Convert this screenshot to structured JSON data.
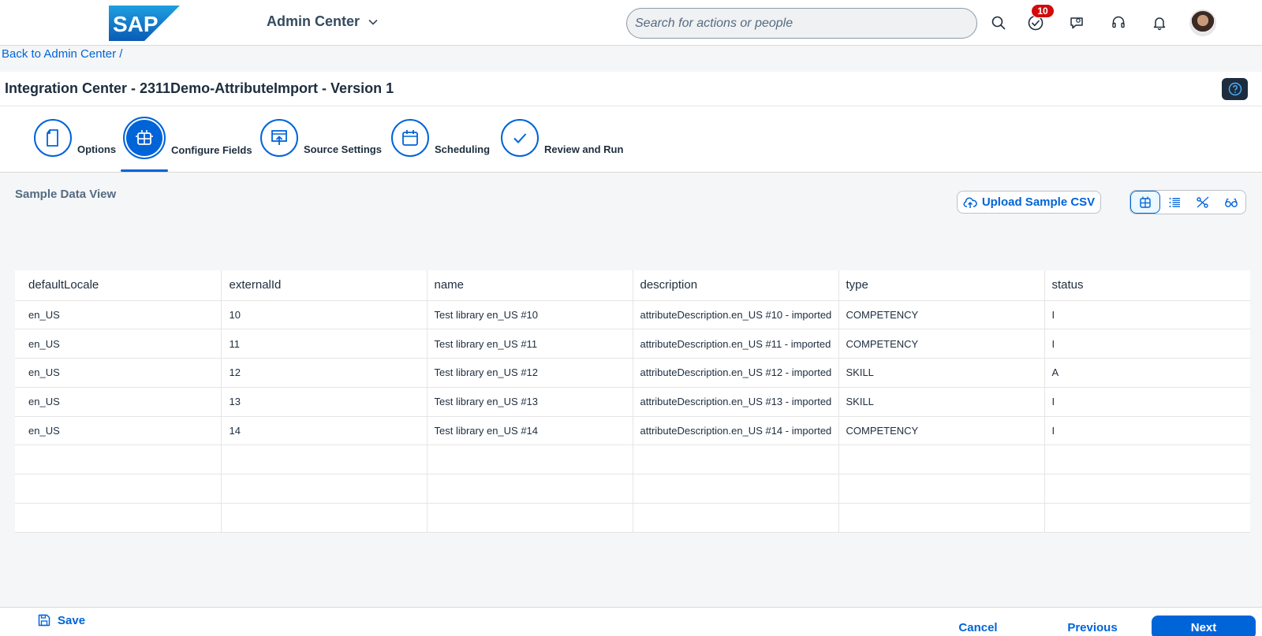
{
  "shell": {
    "logo_text": "SAP",
    "app_title": "Admin Center",
    "search_placeholder": "Search for actions or people",
    "notification_count": "10"
  },
  "breadcrumb": "Back to Admin Center /",
  "page": {
    "title": "Integration Center - 2311Demo-AttributeImport - Version 1"
  },
  "wizard": {
    "steps": [
      {
        "label": "Options"
      },
      {
        "label": "Configure Fields"
      },
      {
        "label": "Source Settings"
      },
      {
        "label": "Scheduling"
      },
      {
        "label": "Review and Run"
      }
    ],
    "active_index": 1
  },
  "content": {
    "section_title": "Sample Data View",
    "upload_label": "Upload Sample CSV"
  },
  "table": {
    "columns": [
      "defaultLocale",
      "externalId",
      "name",
      "description",
      "type",
      "status"
    ],
    "rows": [
      [
        "en_US",
        "10",
        "Test library en_US #10",
        "attributeDescription.en_US #10 - imported",
        "COMPETENCY",
        "I"
      ],
      [
        "en_US",
        "11",
        "Test library en_US #11",
        "attributeDescription.en_US #11 - imported",
        "COMPETENCY",
        "I"
      ],
      [
        "en_US",
        "12",
        "Test library en_US #12",
        "attributeDescription.en_US #12 - imported",
        "SKILL",
        "A"
      ],
      [
        "en_US",
        "13",
        "Test library en_US #13",
        "attributeDescription.en_US #13 - imported",
        "SKILL",
        "I"
      ],
      [
        "en_US",
        "14",
        "Test library en_US #14",
        "attributeDescription.en_US #14 - imported",
        "COMPETENCY",
        "I"
      ],
      [
        "",
        "",
        "",
        "",
        "",
        ""
      ],
      [
        "",
        "",
        "",
        "",
        "",
        ""
      ],
      [
        "",
        "",
        "",
        "",
        "",
        ""
      ]
    ]
  },
  "footer": {
    "save_label": "Save",
    "cancel_label": "Cancel",
    "previous_label": "Previous",
    "next_label": "Next"
  },
  "colors": {
    "accent": "#0064d9",
    "header_dark": "#1d2d3e",
    "badge": "#d20a0a"
  }
}
